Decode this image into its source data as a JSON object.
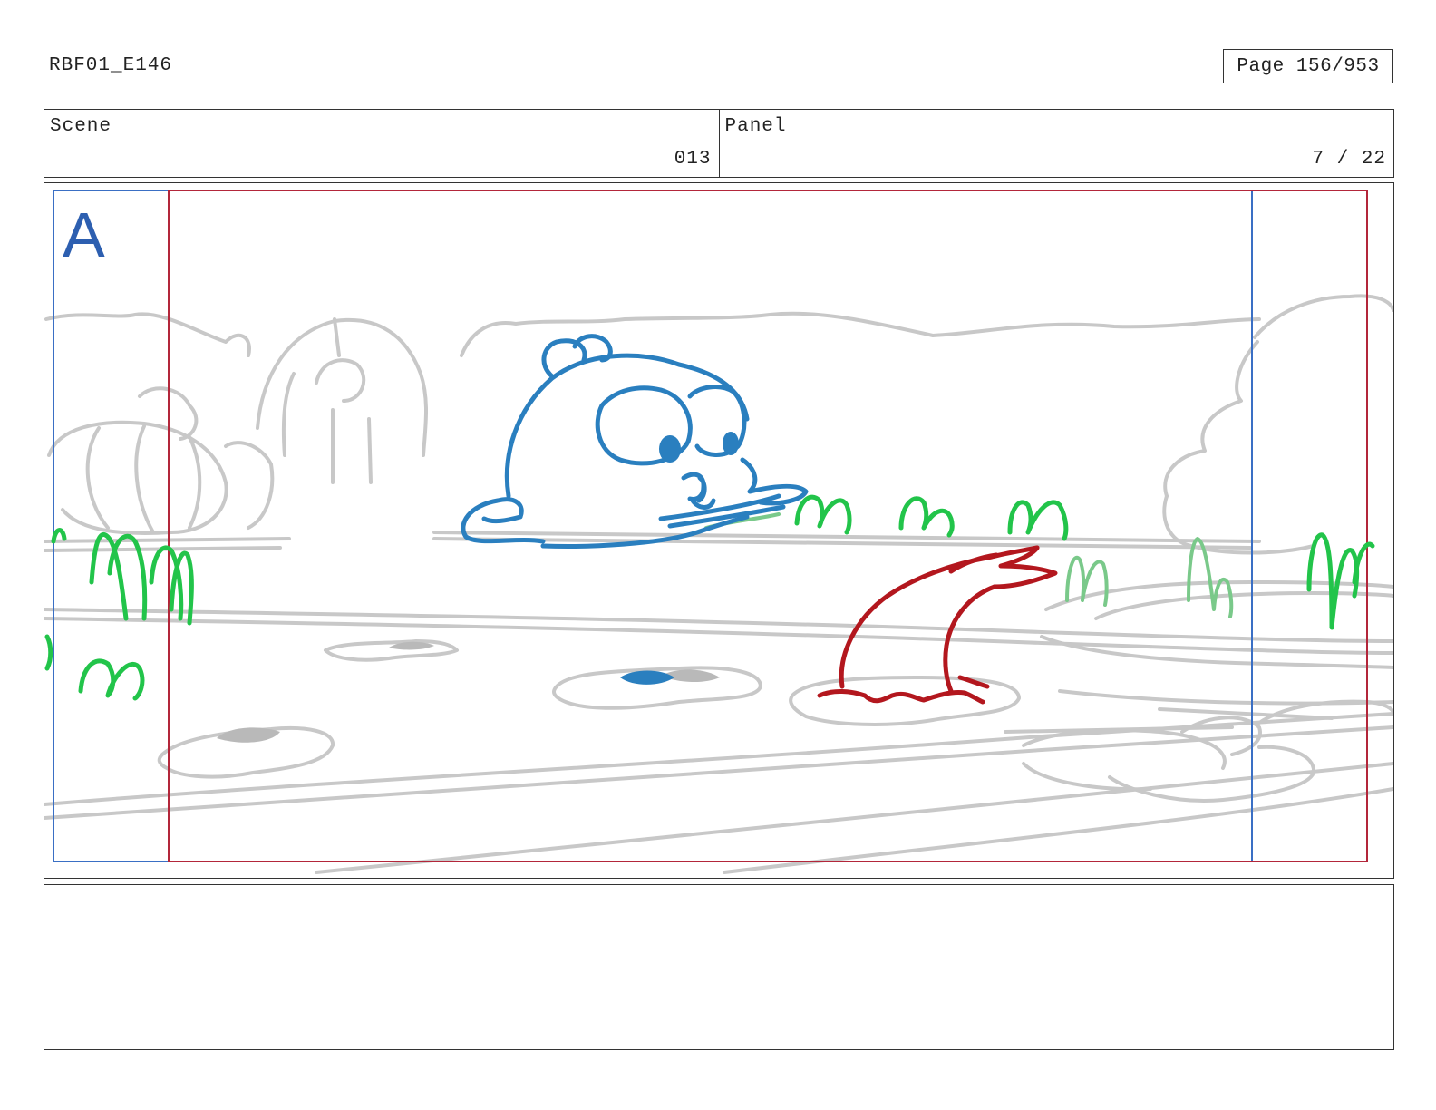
{
  "header": {
    "doc_id": "RBF01_E146",
    "page_label": "Page 156/953"
  },
  "scene": {
    "label": "Scene",
    "value": "013"
  },
  "panel": {
    "label": "Panel",
    "value": "7 / 22"
  },
  "frame": {
    "layer_label": "A"
  },
  "colors": {
    "sketch_blue": "#2a7fbf",
    "sketch_red": "#b3171e",
    "sketch_green": "#22c44a",
    "sketch_gray": "#c8c8c8",
    "guide_blue": "#3a6fc4",
    "guide_red": "#b3263a"
  },
  "notes": {
    "text": ""
  }
}
